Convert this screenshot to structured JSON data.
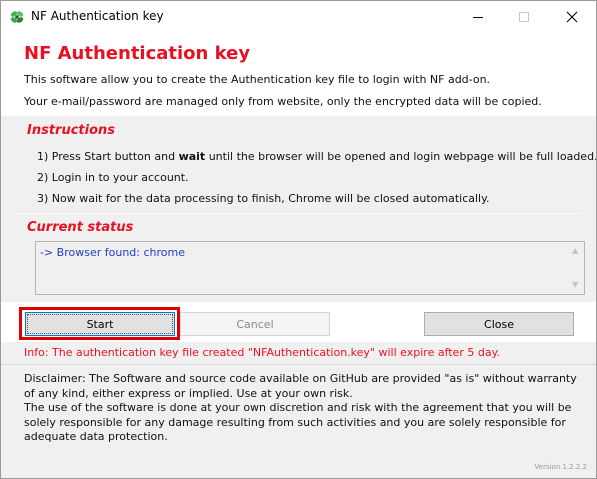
{
  "window": {
    "title": "NF Authentication key",
    "icon": "green-leaf-icon"
  },
  "header": {
    "title": "NF Authentication key",
    "description_1": "This software allow you to create the Authentication key file to login with NF add-on.",
    "description_2": "Your e-mail/password are managed only from website, only the encrypted data will be copied."
  },
  "instructions": {
    "heading": "Instructions",
    "step1": {
      "before": "1) Press Start button and ",
      "bold": "wait",
      "after": " until the browser will be opened and login webpage will be full loaded."
    },
    "step2": "2) Login in to your account.",
    "step3": "3) Now wait for the data processing to finish, Chrome will be closed automatically."
  },
  "status": {
    "heading": "Current status",
    "text": "-> Browser found: chrome"
  },
  "buttons": {
    "start": "Start",
    "cancel": "Cancel",
    "close": "Close"
  },
  "info": "Info: The authentication key file created \"NFAuthentication.key\" will expire after 5 day.",
  "disclaimer": {
    "p1": "Disclaimer: The Software and source code available on GitHub are provided \"as is\" without warranty of any kind, either express or implied. Use at your own risk.",
    "p2": "The use of the software is done at your own discretion and risk with the agreement that you will be solely responsible for any damage resulting from such activities and you are solely responsible for adequate data protection."
  },
  "version": "Version 1.2.2.2",
  "colors": {
    "accent_red": "#e81123",
    "status_blue": "#1f3fc5",
    "highlight_red": "#e00000",
    "focus_blue": "#0078d7"
  }
}
